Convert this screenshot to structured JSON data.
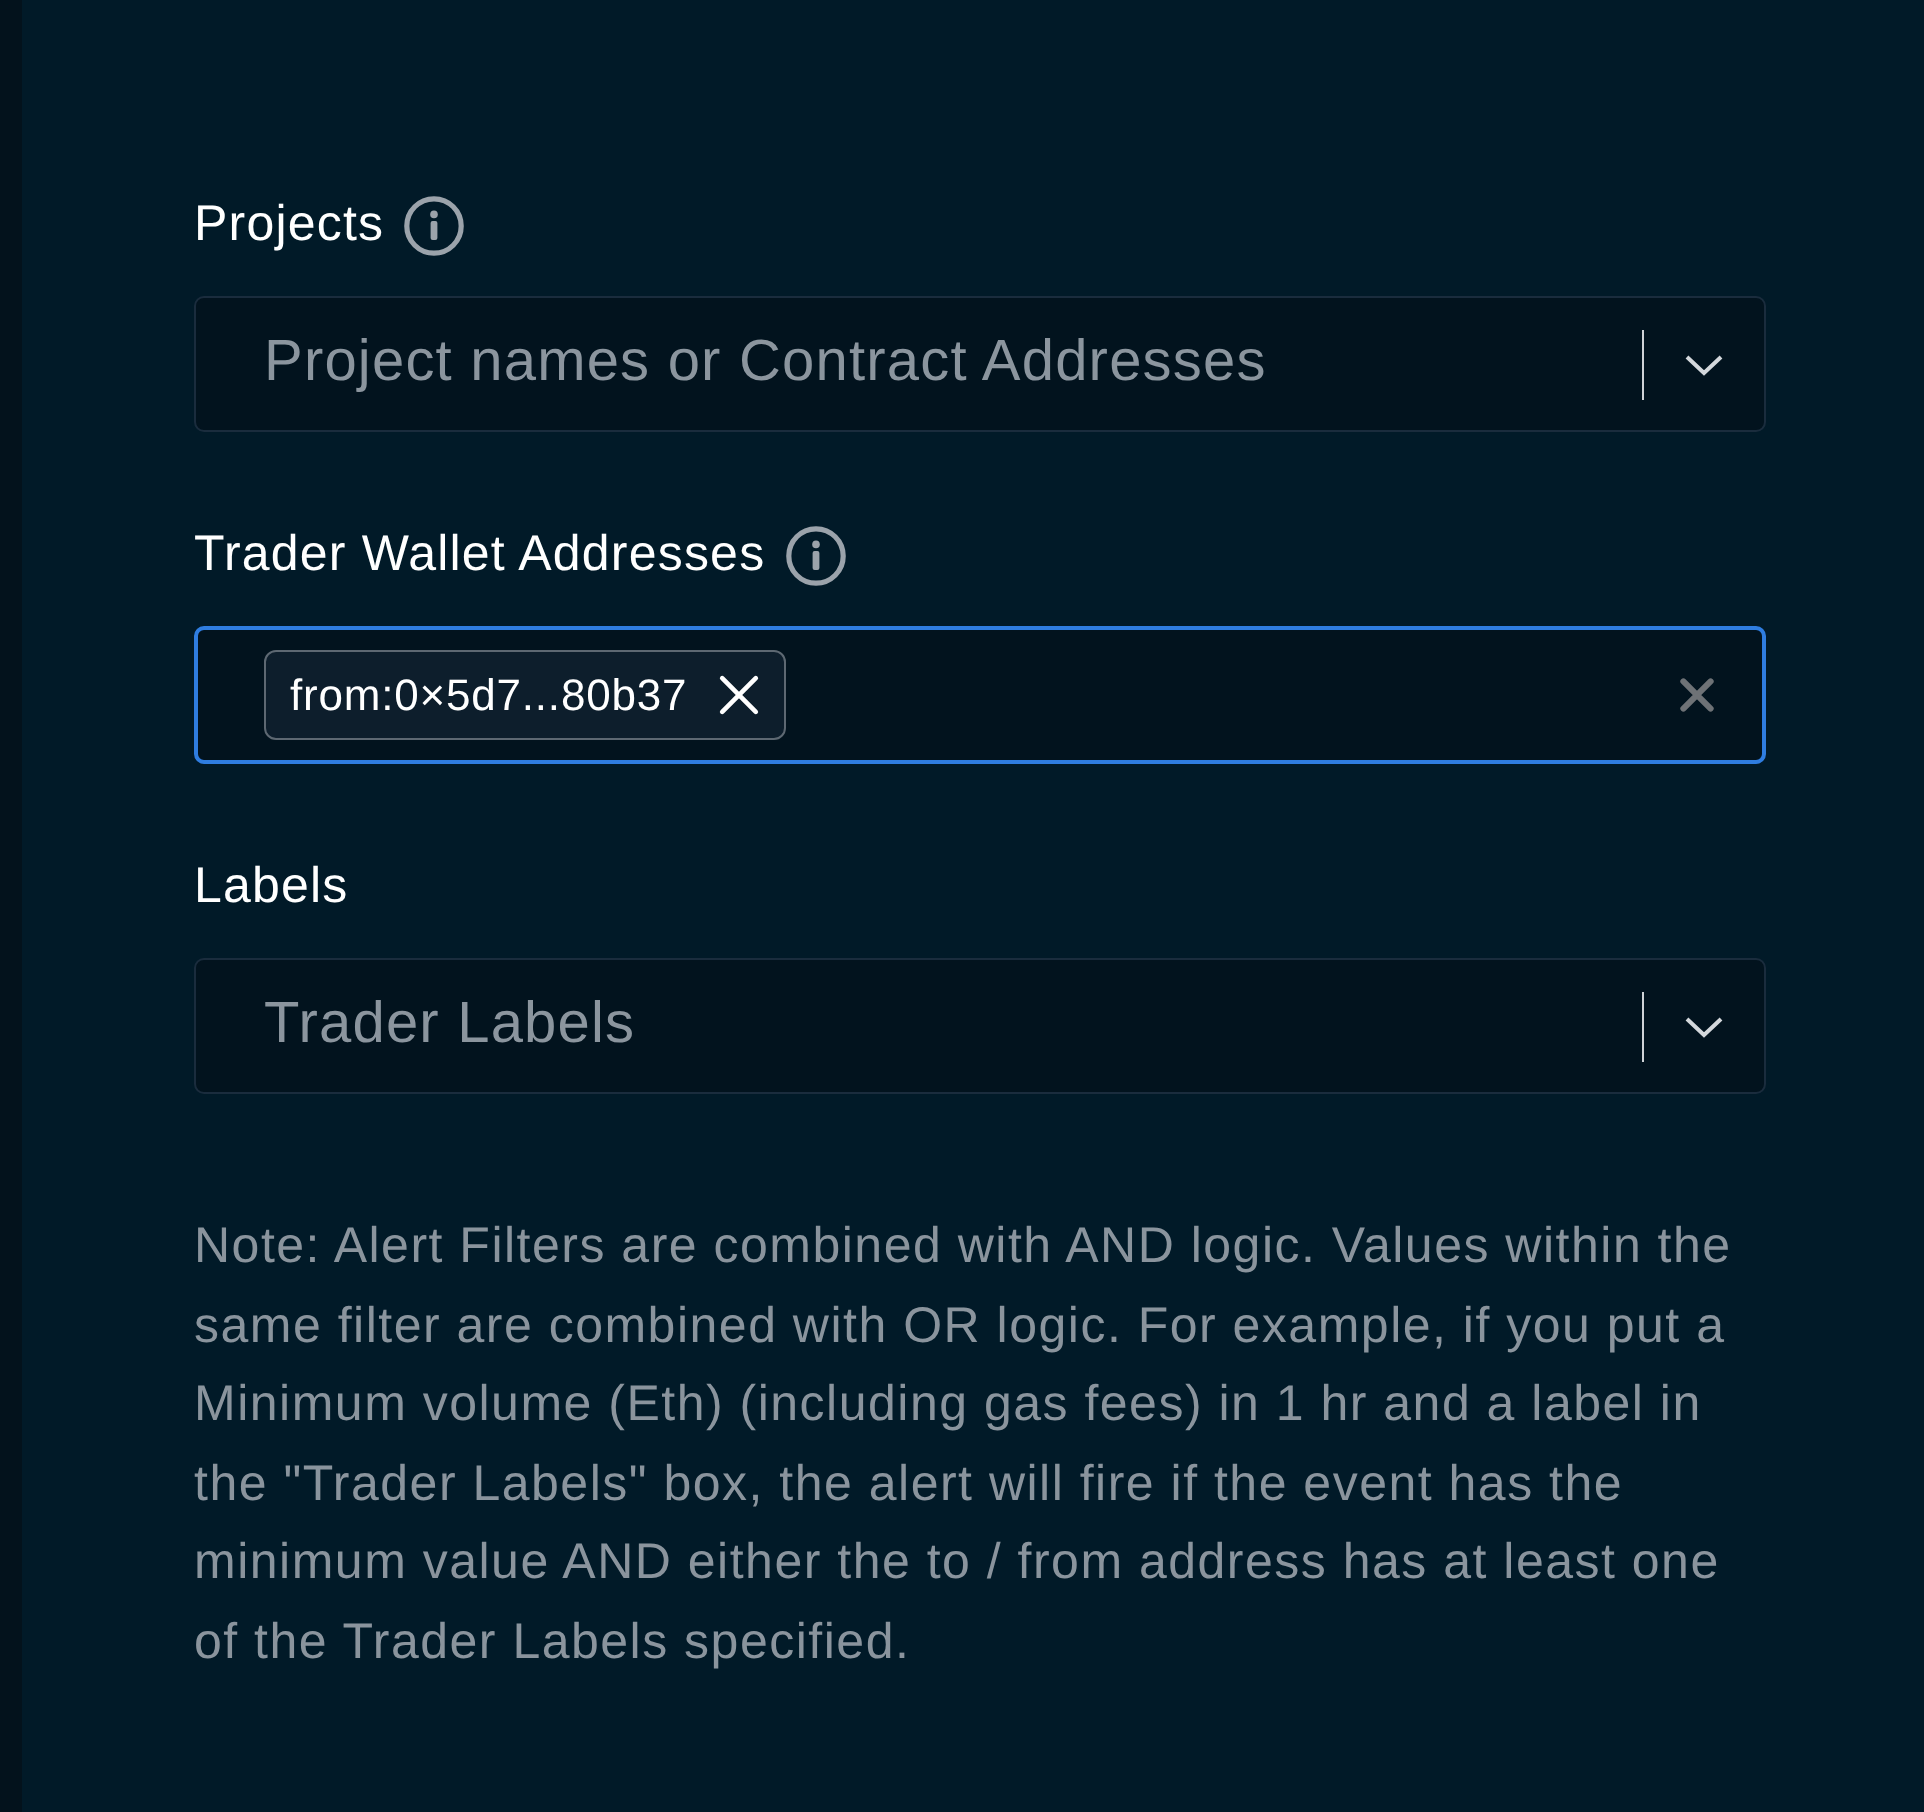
{
  "fields": [
    {
      "kind": "select",
      "label": "Projects",
      "info": true,
      "focused": false,
      "placeholder": "Project names or Contract Addresses"
    },
    {
      "kind": "tags",
      "label": "Trader Wallet Addresses",
      "info": true,
      "focused": true,
      "tags": [
        {
          "text": "from:0×5d7...80b37"
        }
      ]
    },
    {
      "kind": "select",
      "label": "Labels",
      "info": false,
      "focused": false,
      "placeholder": "Trader Labels"
    }
  ],
  "note": "Note: Alert Filters are combined with AND logic. Values within the same filter are combined with OR logic. For example, if you put a Minimum volume (Eth) (including gas fees) in 1 hr and a label in the \"Trader Labels\" box, the alert will fire if the event has the minimum value AND either the to / from address has at least one of the Trader Labels specified."
}
